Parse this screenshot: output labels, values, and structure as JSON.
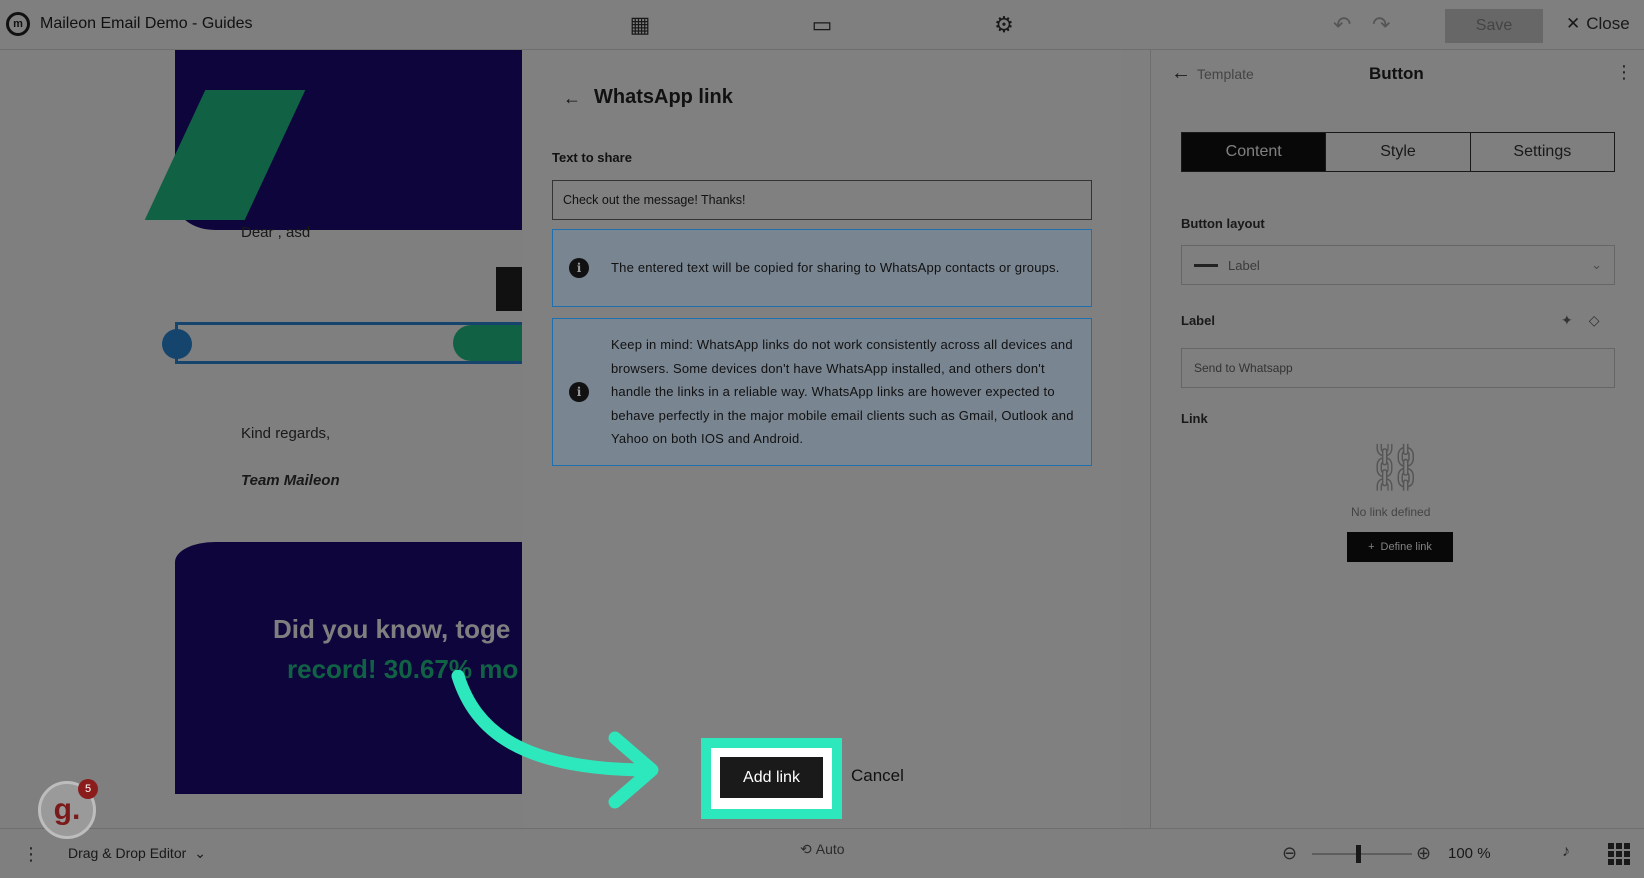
{
  "app": {
    "title": "Maileon Email Demo - Guides",
    "logo_text": "m",
    "save_label": "Save",
    "close_label": "Close"
  },
  "canvas": {
    "greeting": "Dear , asd",
    "regards": "Kind regards,",
    "team": "Team Maileon",
    "banner_line1": "Did you know, toge",
    "banner_line2": "record! 30.67% mo"
  },
  "right_panel": {
    "breadcrumb": "Template",
    "title": "Button",
    "tabs": [
      "Content",
      "Style",
      "Settings"
    ],
    "active_tab": "Content",
    "layout_label": "Button layout",
    "layout_value": "Label",
    "label_label": "Label",
    "label_value": "Send to Whatsapp",
    "link_label": "Link",
    "no_link": "No link defined",
    "define_link": "Define link"
  },
  "bottom_bar": {
    "mode": "Drag & Drop Editor",
    "autosave": "Auto",
    "zoom": "100 %"
  },
  "dialog": {
    "title": "WhatsApp link",
    "text_label": "Text to share",
    "text_value": "Check out the message! Thanks!",
    "info1": "The entered text will be copied for sharing to WhatsApp contacts or groups.",
    "info2": "Keep in mind: WhatsApp links do not work consistently across all devices and browsers. Some devices don't have WhatsApp installed, and others don't handle the links in a reliable way. WhatsApp links are however expected to behave perfectly in the major mobile email clients such as Gmail, Outlook and Yahoo on both IOS and Android.",
    "add_link": "Add link",
    "cancel": "Cancel"
  },
  "guide_badge": {
    "letter": "g.",
    "count": "5"
  },
  "icons": {
    "back": "arrow-left-icon",
    "info": "info-icon",
    "arrow": "curved-arrow-icon"
  },
  "colors": {
    "highlight": "#2ee8bd",
    "info_border": "#1e6fae",
    "brand_purple": "#1d0a7a",
    "brand_green": "#22c48a"
  }
}
